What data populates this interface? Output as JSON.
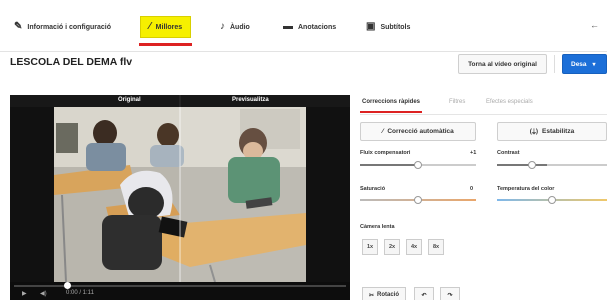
{
  "nav": {
    "tabs": [
      {
        "label": "Informació i configuració",
        "icon": "pencil-icon"
      },
      {
        "label": "Millores",
        "icon": "magic-wand-icon"
      },
      {
        "label": "Àudio",
        "icon": "music-note-icon"
      },
      {
        "label": "Anotacions",
        "icon": "speech-bubble-icon"
      },
      {
        "label": "Subtítols",
        "icon": "subtitles-icon"
      }
    ],
    "back": "←"
  },
  "video_title": "LESCOLA DEL DEMA flv",
  "actions": {
    "revert": "Torna al vídeo original",
    "save": "Desa",
    "save_caret": "▾"
  },
  "preview": {
    "original_label": "Original",
    "preview_label": "Previsualitza",
    "time": "0:00 / 1:11",
    "play": "▶",
    "volume": "◀)"
  },
  "panel": {
    "tabs": [
      "Correccions ràpides",
      "Filtres",
      "Efectes especials"
    ],
    "auto_fix": "Correcció automàtica",
    "stabilize": "Estabilitza",
    "sliders": [
      {
        "label": "Fluix compensatori",
        "value": "+1",
        "level": 0.5
      },
      {
        "label": "Contrast",
        "value": "",
        "level": 0.45
      },
      {
        "label": "Saturació",
        "value": "0",
        "level": 0.5
      },
      {
        "label": "Temperatura del color",
        "value": "",
        "level": 0.5
      }
    ],
    "slow_motion": {
      "title": "Càmera lenta",
      "options": [
        "1x",
        "2x",
        "4x",
        "8x"
      ]
    },
    "rotate": {
      "label": "Rotació",
      "left_icon": "↶",
      "right_icon": "↷"
    }
  },
  "colors": {
    "accent_red": "#dd2222",
    "active_tab_yellow": "#f6f000",
    "save_blue": "#1c6fd8"
  }
}
